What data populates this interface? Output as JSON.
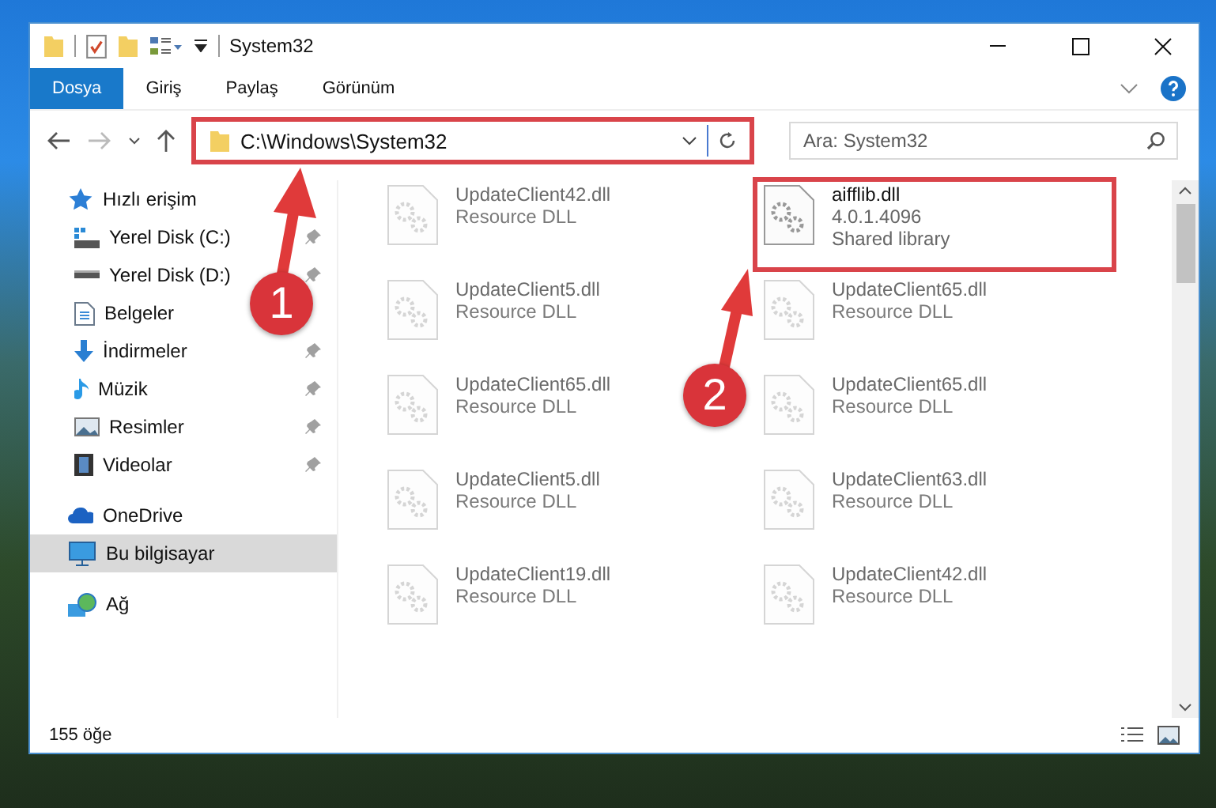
{
  "window": {
    "title": "System32"
  },
  "ribbon_tabs": [
    {
      "label": "Dosya",
      "selected": true
    },
    {
      "label": "Giriş",
      "selected": false
    },
    {
      "label": "Paylaş",
      "selected": false
    },
    {
      "label": "Görünüm",
      "selected": false
    }
  ],
  "address_bar": {
    "path": "C:\\Windows\\System32",
    "highlighted": true
  },
  "search": {
    "placeholder": "Ara: System32"
  },
  "sidebar": {
    "items": [
      {
        "label": "Hızlı erişim",
        "kind": "star",
        "selected": false,
        "children": [
          {
            "label": "Yerel Disk (C:)",
            "kind": "systemdrive",
            "pinned": true,
            "selected": false
          },
          {
            "label": "Yerel Disk (D:)",
            "kind": "drive",
            "pinned": true,
            "selected": false
          },
          {
            "label": "Belgeler",
            "kind": "documents",
            "pinned": false,
            "selected": false
          },
          {
            "label": "İndirmeler",
            "kind": "downloads",
            "pinned": true,
            "selected": false
          },
          {
            "label": "Müzik",
            "kind": "music",
            "pinned": true,
            "selected": false
          },
          {
            "label": "Resimler",
            "kind": "pictures",
            "pinned": true,
            "selected": false
          },
          {
            "label": "Videolar",
            "kind": "videos",
            "pinned": true,
            "selected": false
          }
        ]
      },
      {
        "label": "OneDrive",
        "kind": "cloud",
        "selected": false
      },
      {
        "label": "Bu bilgisayar",
        "kind": "computer",
        "selected": true
      },
      {
        "label": "Ağ",
        "kind": "network",
        "selected": false
      }
    ]
  },
  "files": [
    {
      "name": "UpdateClient42.dll",
      "details": [
        "Resource DLL"
      ],
      "faded": true,
      "highlighted": false
    },
    {
      "name": "aifflib.dll",
      "details": [
        "4.0.1.4096",
        "Shared library"
      ],
      "faded": false,
      "highlighted": true
    },
    {
      "name": "UpdateClient5.dll",
      "details": [
        "Resource DLL"
      ],
      "faded": true,
      "highlighted": false
    },
    {
      "name": "UpdateClient65.dll",
      "details": [
        "Resource DLL"
      ],
      "faded": true,
      "highlighted": false
    },
    {
      "name": "UpdateClient65.dll",
      "details": [
        "Resource DLL"
      ],
      "faded": true,
      "highlighted": false
    },
    {
      "name": "UpdateClient65.dll",
      "details": [
        "Resource DLL"
      ],
      "faded": true,
      "highlighted": false
    },
    {
      "name": "UpdateClient5.dll",
      "details": [
        "Resource DLL"
      ],
      "faded": true,
      "highlighted": false
    },
    {
      "name": "UpdateClient63.dll",
      "details": [
        "Resource DLL"
      ],
      "faded": true,
      "highlighted": false
    },
    {
      "name": "UpdateClient19.dll",
      "details": [
        "Resource DLL"
      ],
      "faded": true,
      "highlighted": false
    },
    {
      "name": "UpdateClient42.dll",
      "details": [
        "Resource DLL"
      ],
      "faded": true,
      "highlighted": false
    }
  ],
  "status_bar": {
    "item_count": "155 öğe"
  },
  "callouts": [
    {
      "number": "1"
    },
    {
      "number": "2"
    }
  ]
}
